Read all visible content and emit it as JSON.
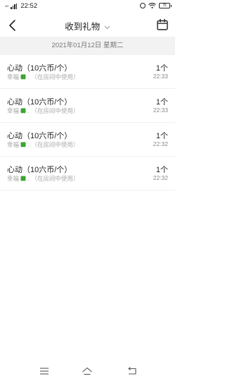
{
  "status_bar": {
    "signal_label": "4G",
    "time": "22:52",
    "battery": "76"
  },
  "header": {
    "title": "收到礼物"
  },
  "date_header": "2021年01月12日 星期二",
  "gifts": [
    {
      "name": "心动（10六币/个）",
      "sender": "幸福",
      "note": "（在房间中使用）",
      "count": "1个",
      "time": "22:33"
    },
    {
      "name": "心动（10六币/个）",
      "sender": "幸福",
      "note": "（在房间中使用）",
      "count": "1个",
      "time": "22:33"
    },
    {
      "name": "心动（10六币/个）",
      "sender": "幸福",
      "note": "（在房间中使用）",
      "count": "1个",
      "time": "22:32"
    },
    {
      "name": "心动（10六币/个）",
      "sender": "幸福",
      "note": "（在房间中使用）",
      "count": "1个",
      "time": "22:32"
    }
  ],
  "colors": {
    "clover": "#3fa535",
    "date_bar_bg": "#f2f2f2"
  }
}
